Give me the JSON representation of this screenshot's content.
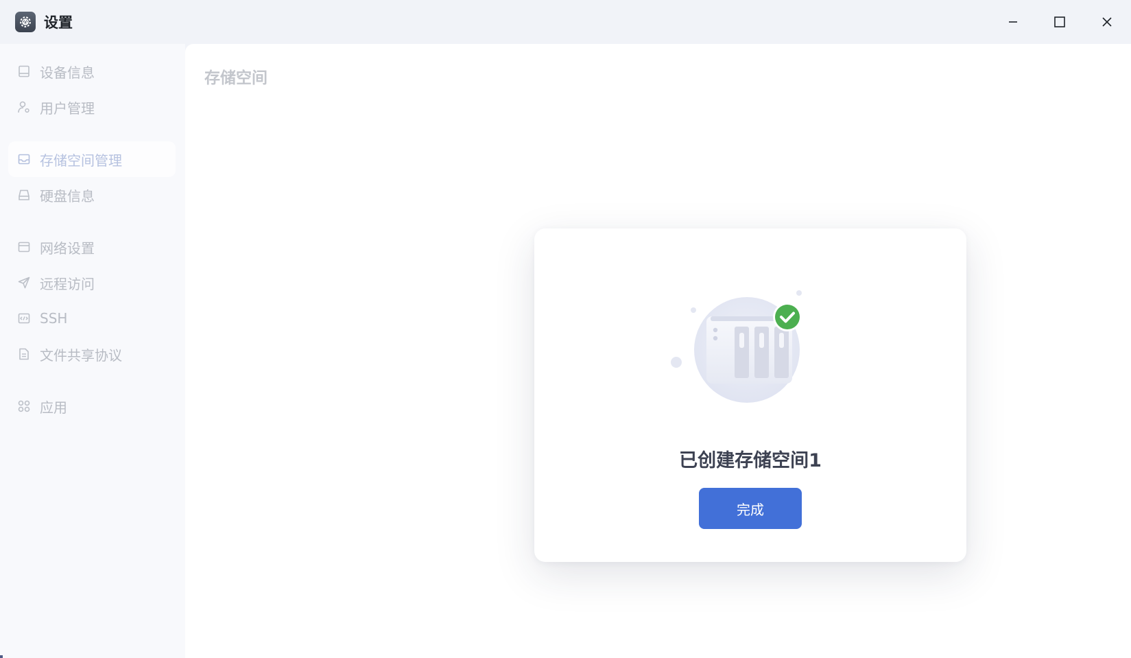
{
  "window": {
    "title": "设置",
    "app_icon": "gear-icon",
    "controls": [
      "minimize-icon",
      "maximize-icon",
      "close-icon"
    ]
  },
  "sidebar": {
    "items": [
      {
        "label": "设备信息",
        "icon": "device-icon"
      },
      {
        "label": "用户管理",
        "icon": "user-gear-icon"
      },
      {
        "label": "存储空间管理",
        "icon": "inbox-storage-icon",
        "active": true
      },
      {
        "label": "硬盘信息",
        "icon": "disk-icon"
      },
      {
        "label": "网络设置",
        "icon": "network-card-icon"
      },
      {
        "label": "远程访问",
        "icon": "send-icon"
      },
      {
        "label": "SSH",
        "icon": "code-icon"
      },
      {
        "label": "文件共享协议",
        "icon": "file-icon"
      },
      {
        "label": "应用",
        "icon": "apps-grid-icon"
      }
    ]
  },
  "main": {
    "title": "存储空间"
  },
  "dialog": {
    "illustration": "nas-success-icon",
    "message": "已创建存储空间1",
    "done_label": "完成"
  },
  "colors": {
    "accent": "#4270d8",
    "success": "#4caf50",
    "background": "#f1f3f8"
  }
}
